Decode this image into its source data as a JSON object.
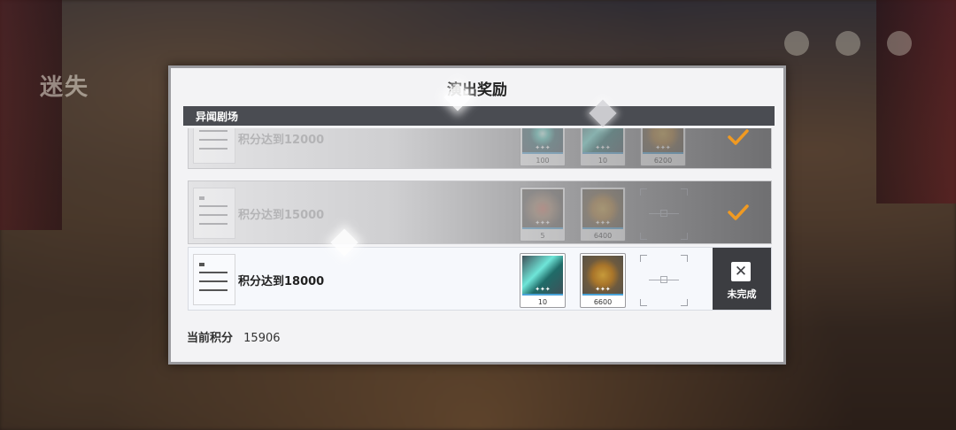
{
  "background": {
    "title": "迷失",
    "text": "",
    "bottom_text": ""
  },
  "dialog": {
    "title": "演出奖励",
    "section": "异闻剧场",
    "doc_caption": "",
    "rewards": [
      {
        "label": "积分达到12000",
        "status": "completed",
        "items": [
          {
            "icon": "crystal-icon",
            "count": "100"
          },
          {
            "icon": "rod-icon",
            "count": "10"
          },
          {
            "icon": "coin-icon",
            "count": "6200"
          }
        ]
      },
      {
        "label": "积分达到15000",
        "status": "completed",
        "items": [
          {
            "icon": "flower-icon",
            "count": "5"
          },
          {
            "icon": "coin-icon",
            "count": "6400"
          }
        ]
      },
      {
        "label": "积分达到18000",
        "status": "incomplete",
        "status_text": "未完成",
        "items": [
          {
            "icon": "rod-icon",
            "count": "10"
          },
          {
            "icon": "coin-icon",
            "count": "6600"
          }
        ]
      }
    ],
    "score_label": "当前积分",
    "score_value": "15906"
  },
  "colors": {
    "check": "#f09a22",
    "section_bar": "#4a4c52",
    "status_box": "#3c3d41"
  }
}
